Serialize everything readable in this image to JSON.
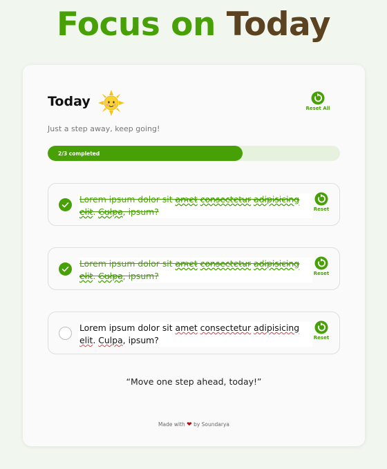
{
  "app": {
    "title_part1": "Focus on",
    "title_part2": "Today",
    "colors": {
      "green": "#48a007",
      "brown": "#5b4220"
    }
  },
  "card": {
    "heading": "Today",
    "heading_icon": "sun-icon",
    "reset_all_label": "Reset All",
    "subtitle": "Just a step away, keep going!",
    "progress": {
      "label": "2/3 completed",
      "completed": 2,
      "total": 3
    }
  },
  "tasks": [
    {
      "text_a": "Lorem ipsum dolor sit ",
      "text_b": "amet",
      "text_c": " ",
      "text_d": "consectetur",
      "text_e": " ",
      "text_f": "adipisicing",
      "text_g": " ",
      "text_h": "elit",
      "text_i": ". ",
      "text_j": "Culpa",
      "text_k": ", ",
      "text_l": "ipsum",
      "text_m": "?",
      "completed": true,
      "reset_label": "Reset"
    },
    {
      "text_a": "Lorem ipsum dolor sit ",
      "text_b": "amet",
      "text_c": " ",
      "text_d": "consectetur",
      "text_e": " ",
      "text_f": "adipisicing",
      "text_g": " ",
      "text_h": "elit",
      "text_i": ". ",
      "text_j": "Culpa",
      "text_k": ", ",
      "text_l": "ipsum",
      "text_m": "?",
      "completed": true,
      "reset_label": "Reset"
    },
    {
      "text_a": "Lorem ipsum dolor sit ",
      "text_b": "amet",
      "text_c": " ",
      "text_d": "consectetur",
      "text_e": " ",
      "text_f": "adipisicing",
      "text_g": " ",
      "text_h": "elit",
      "text_i": ". ",
      "text_j": "Culpa",
      "text_k": ", ",
      "text_l": "ipsum",
      "text_m": "?",
      "completed": false,
      "reset_label": "Reset"
    }
  ],
  "quote": "“Move one step ahead, today!”",
  "footer": {
    "prefix": "Made with",
    "suffix": "by Soundarya",
    "icon": "heart-icon"
  }
}
